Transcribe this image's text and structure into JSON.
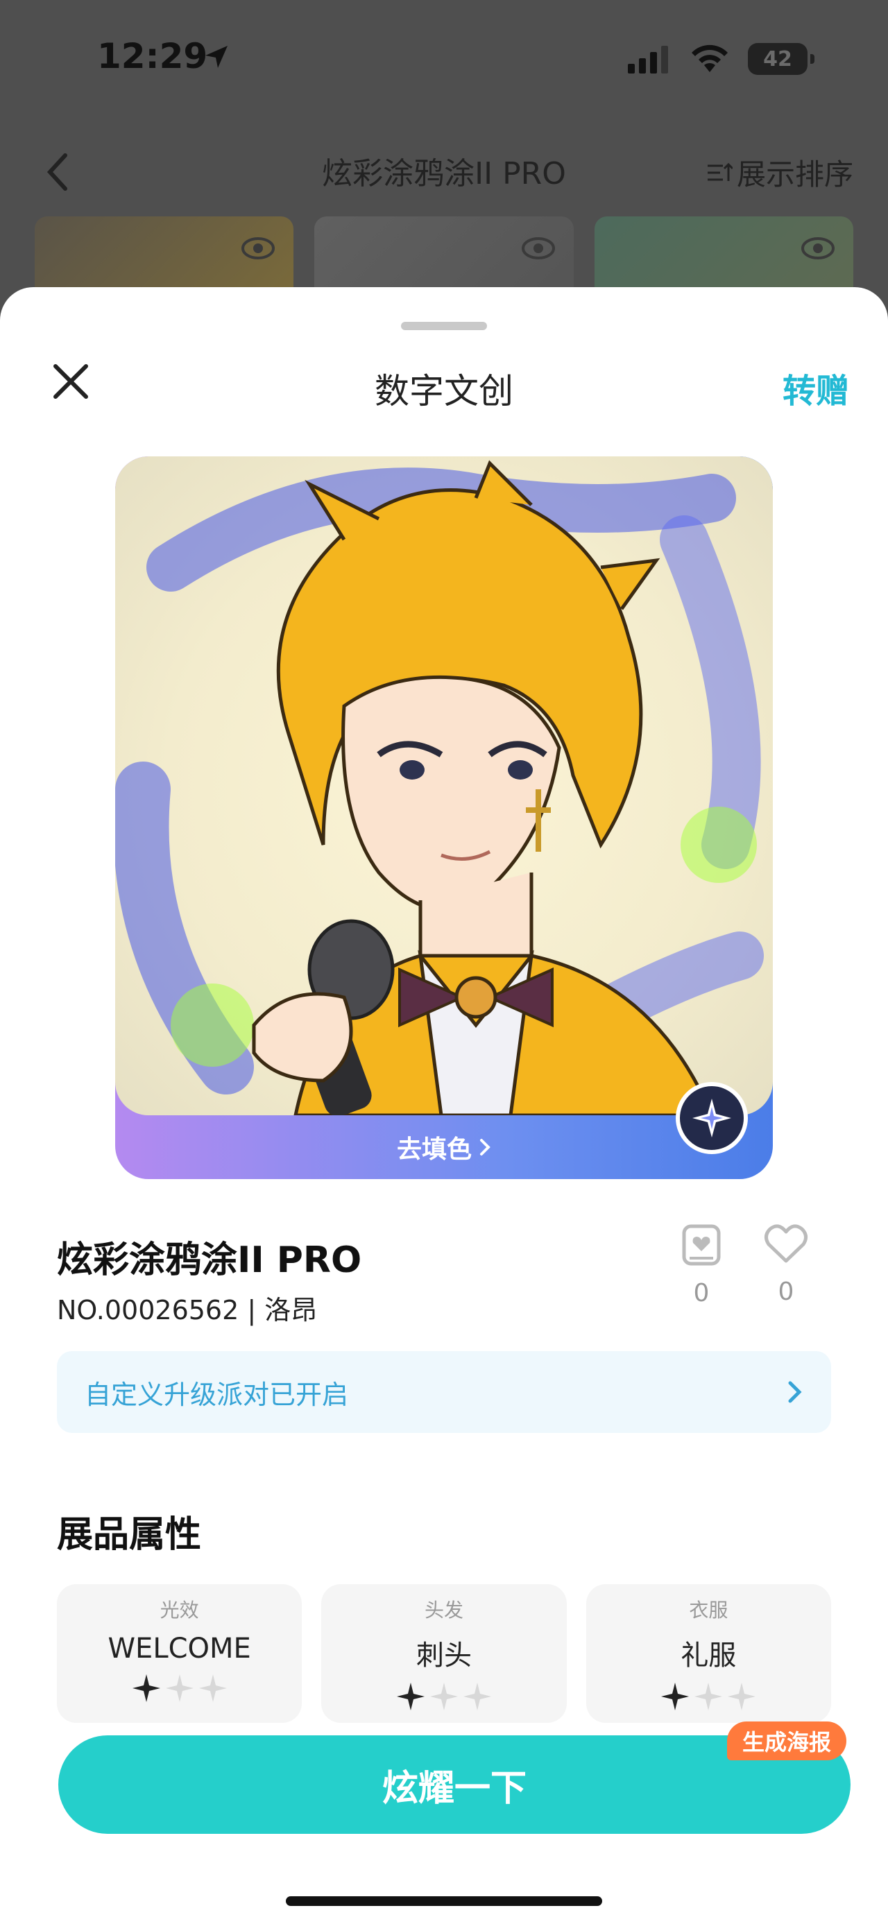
{
  "status_bar": {
    "time": "12:29",
    "battery": "42"
  },
  "background_page": {
    "title": "炫彩涂鸦涂II PRO",
    "sort_label": "展示排序"
  },
  "sheet": {
    "title": "数字文创",
    "gift_label": "转赠",
    "fill_color_link": "去填色",
    "product_name": "炫彩涂鸦涂II PRO",
    "product_no": "NO.00026562 | 洛昂",
    "stats": [
      {
        "icon": "collect-card-icon",
        "count": "0"
      },
      {
        "icon": "heart-icon",
        "count": "0"
      }
    ],
    "banner_text": "自定义升级派对已开启",
    "section_title": "展品属性",
    "attributes": [
      {
        "key": "光效",
        "value": "WELCOME",
        "stars": 1,
        "max_stars": 3
      },
      {
        "key": "头发",
        "value": "刺头",
        "stars": 1,
        "max_stars": 3
      },
      {
        "key": "衣服",
        "value": "礼服",
        "stars": 1,
        "max_stars": 3
      }
    ],
    "cta_label": "炫耀一下",
    "poster_tag": "生成海报"
  },
  "colors": {
    "accent": "#25cfcb",
    "link": "#22b9d4",
    "tag": "#ff7a3c"
  }
}
